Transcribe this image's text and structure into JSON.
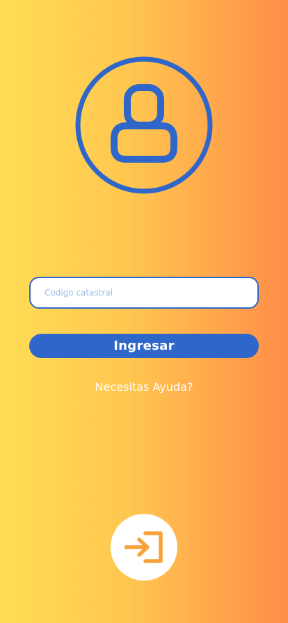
{
  "colors": {
    "gradient_start": "#FFDD55",
    "gradient_end": "#FF8D48",
    "primary_blue": "#2F66C9",
    "accent_orange": "#F7A23A",
    "white": "#FFFFFF"
  },
  "header": {
    "avatar_icon": "user-circle-icon"
  },
  "form": {
    "input_placeholder": "Codigo catastral",
    "input_value": "",
    "submit_label": "Ingresar",
    "help_link": "Necesitas Ayuda?"
  },
  "fab": {
    "icon": "sign-in-icon"
  }
}
